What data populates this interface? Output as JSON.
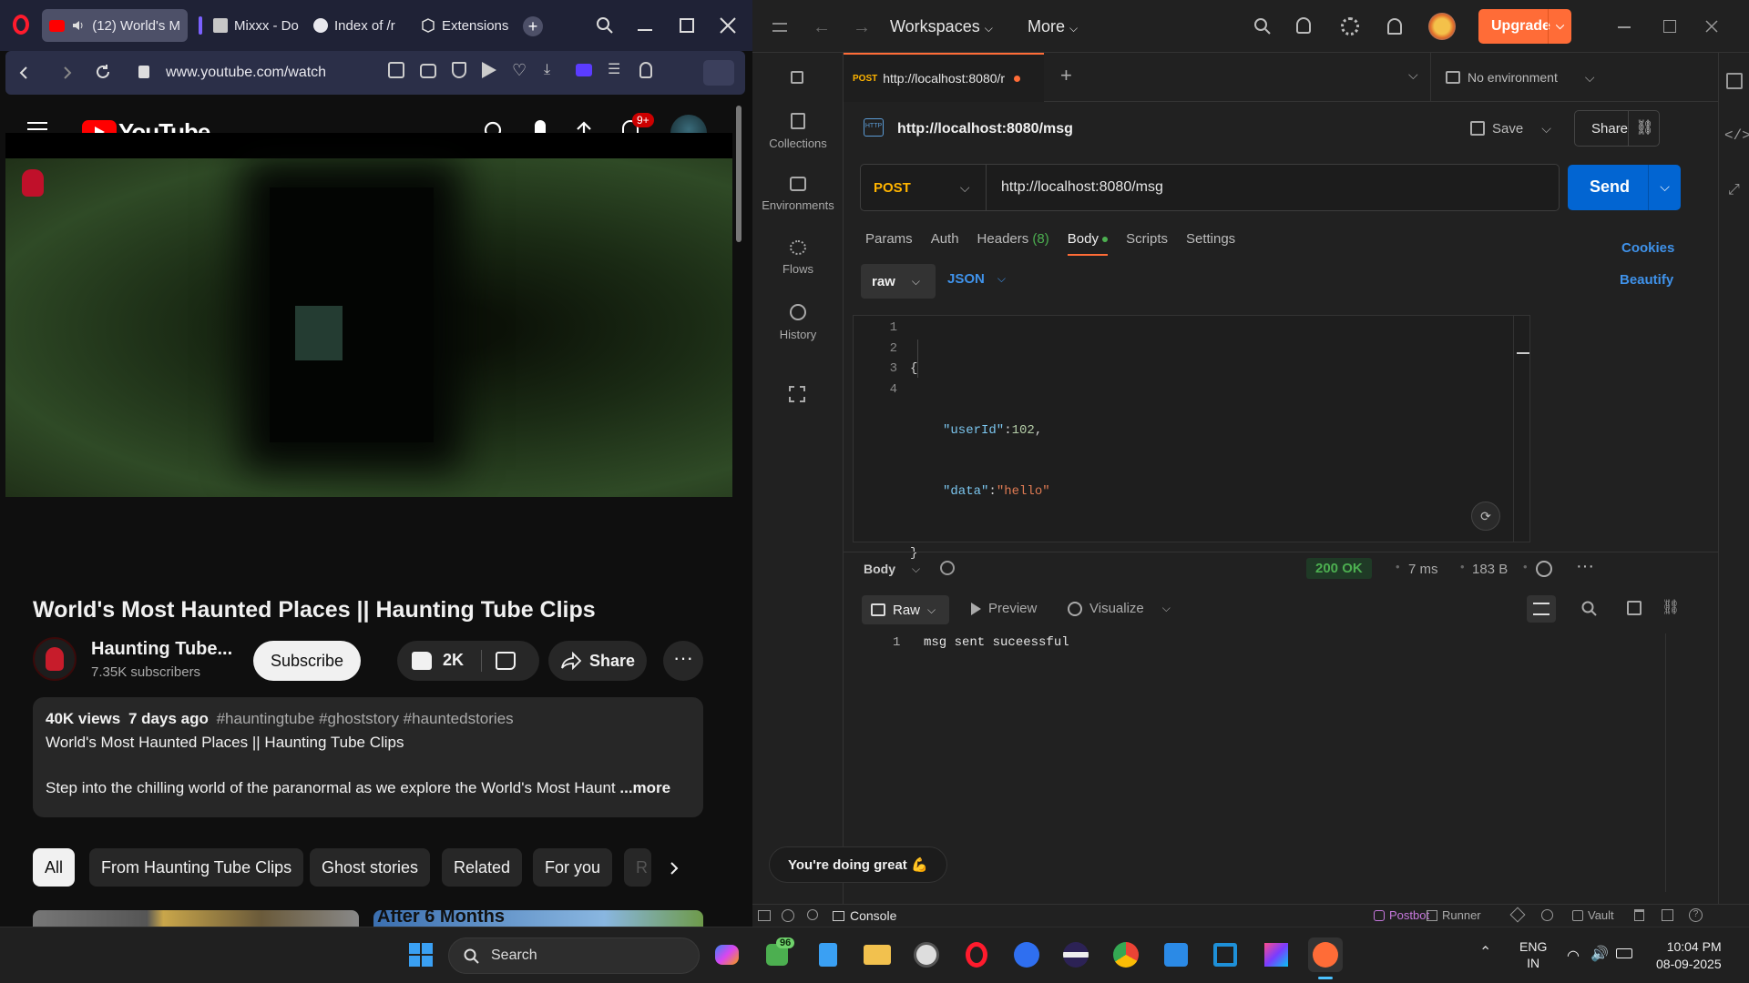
{
  "browser": {
    "tabs": [
      {
        "label": "(12) World's M"
      },
      {
        "label": "Mixxx - Do"
      },
      {
        "label": "Index of /r"
      },
      {
        "label": "Extensions"
      }
    ],
    "url": "www.youtube.com/watch"
  },
  "youtube": {
    "logo": "YouTube",
    "notif_count": "9+",
    "video_title": "World's Most Haunted Places || Haunting Tube Clips",
    "channel": "Haunting Tube...",
    "subscribers": "7.35K subscribers",
    "subscribe": "Subscribe",
    "likes": "2K",
    "share": "Share",
    "views": "40K views",
    "age": "7 days ago",
    "tags": "#hauntingtube #ghoststory #hauntedstories",
    "desc_title": "World's Most Haunted Places  || Haunting Tube Clips",
    "desc_text": "Step into the chilling world of the paranormal as we explore the World's Most Haunt",
    "more": "...more",
    "chips": [
      "All",
      "From Haunting Tube Clips",
      "Ghost stories",
      "Related",
      "For you",
      "R"
    ],
    "thumb_text": "After 6 Months"
  },
  "postman": {
    "nav": {
      "workspaces": "Workspaces",
      "more": "More",
      "upgrade": "Upgrade"
    },
    "tab": {
      "method": "POST",
      "label": "http://localhost:8080/r"
    },
    "environment": "No environment",
    "sidebar": [
      {
        "label": "Collections"
      },
      {
        "label": "Environments"
      },
      {
        "label": "Flows"
      },
      {
        "label": "History"
      }
    ],
    "request": {
      "name": "http://localhost:8080/msg",
      "save": "Save",
      "share": "Share",
      "method": "POST",
      "url": "http://localhost:8080/msg",
      "send": "Send",
      "tabs": {
        "params": "Params",
        "auth": "Auth",
        "headers": "Headers",
        "headers_count": "(8)",
        "body": "Body",
        "scripts": "Scripts",
        "settings": "Settings"
      },
      "cookies": "Cookies",
      "beautify": "Beautify",
      "body_mode": "raw",
      "body_lang": "JSON",
      "line_numbers": [
        "1",
        "2",
        "3",
        "4"
      ],
      "code": {
        "open": "{",
        "key1": "\"userId\"",
        "val1": "102",
        "key2": "\"data\"",
        "val2": "\"hello\"",
        "close": "}"
      }
    },
    "response": {
      "label": "Body",
      "status": "200 OK",
      "time": "7 ms",
      "size": "183 B",
      "view": "Raw",
      "preview": "Preview",
      "visualize": "Visualize",
      "line": "1",
      "text": "msg sent suceessful"
    },
    "toast": "You're doing great 💪",
    "footer": {
      "console": "Console",
      "postbot": "Postbot",
      "runner": "Runner",
      "vault": "Vault"
    }
  },
  "taskbar": {
    "search": "Search",
    "badge": "96",
    "lang_top": "ENG",
    "lang_bottom": "IN",
    "time": "10:04 PM",
    "date": "08-09-2025"
  }
}
